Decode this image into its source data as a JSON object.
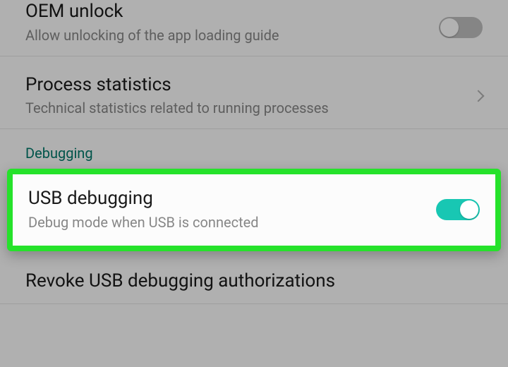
{
  "rows": {
    "oem": {
      "title": "OEM unlock",
      "subtitle": "Allow unlocking of the app loading guide",
      "switch": "off"
    },
    "process": {
      "title": "Process statistics",
      "subtitle": "Technical statistics related to running processes"
    },
    "section_debugging": "Debugging",
    "usb_debug": {
      "title": "USB debugging",
      "subtitle": "Debug mode when USB is connected",
      "switch": "on"
    },
    "revoke": {
      "title": "Revoke USB debugging authorizations"
    }
  },
  "colors": {
    "accent": "#18c7b3",
    "highlight": "#25e22a"
  }
}
